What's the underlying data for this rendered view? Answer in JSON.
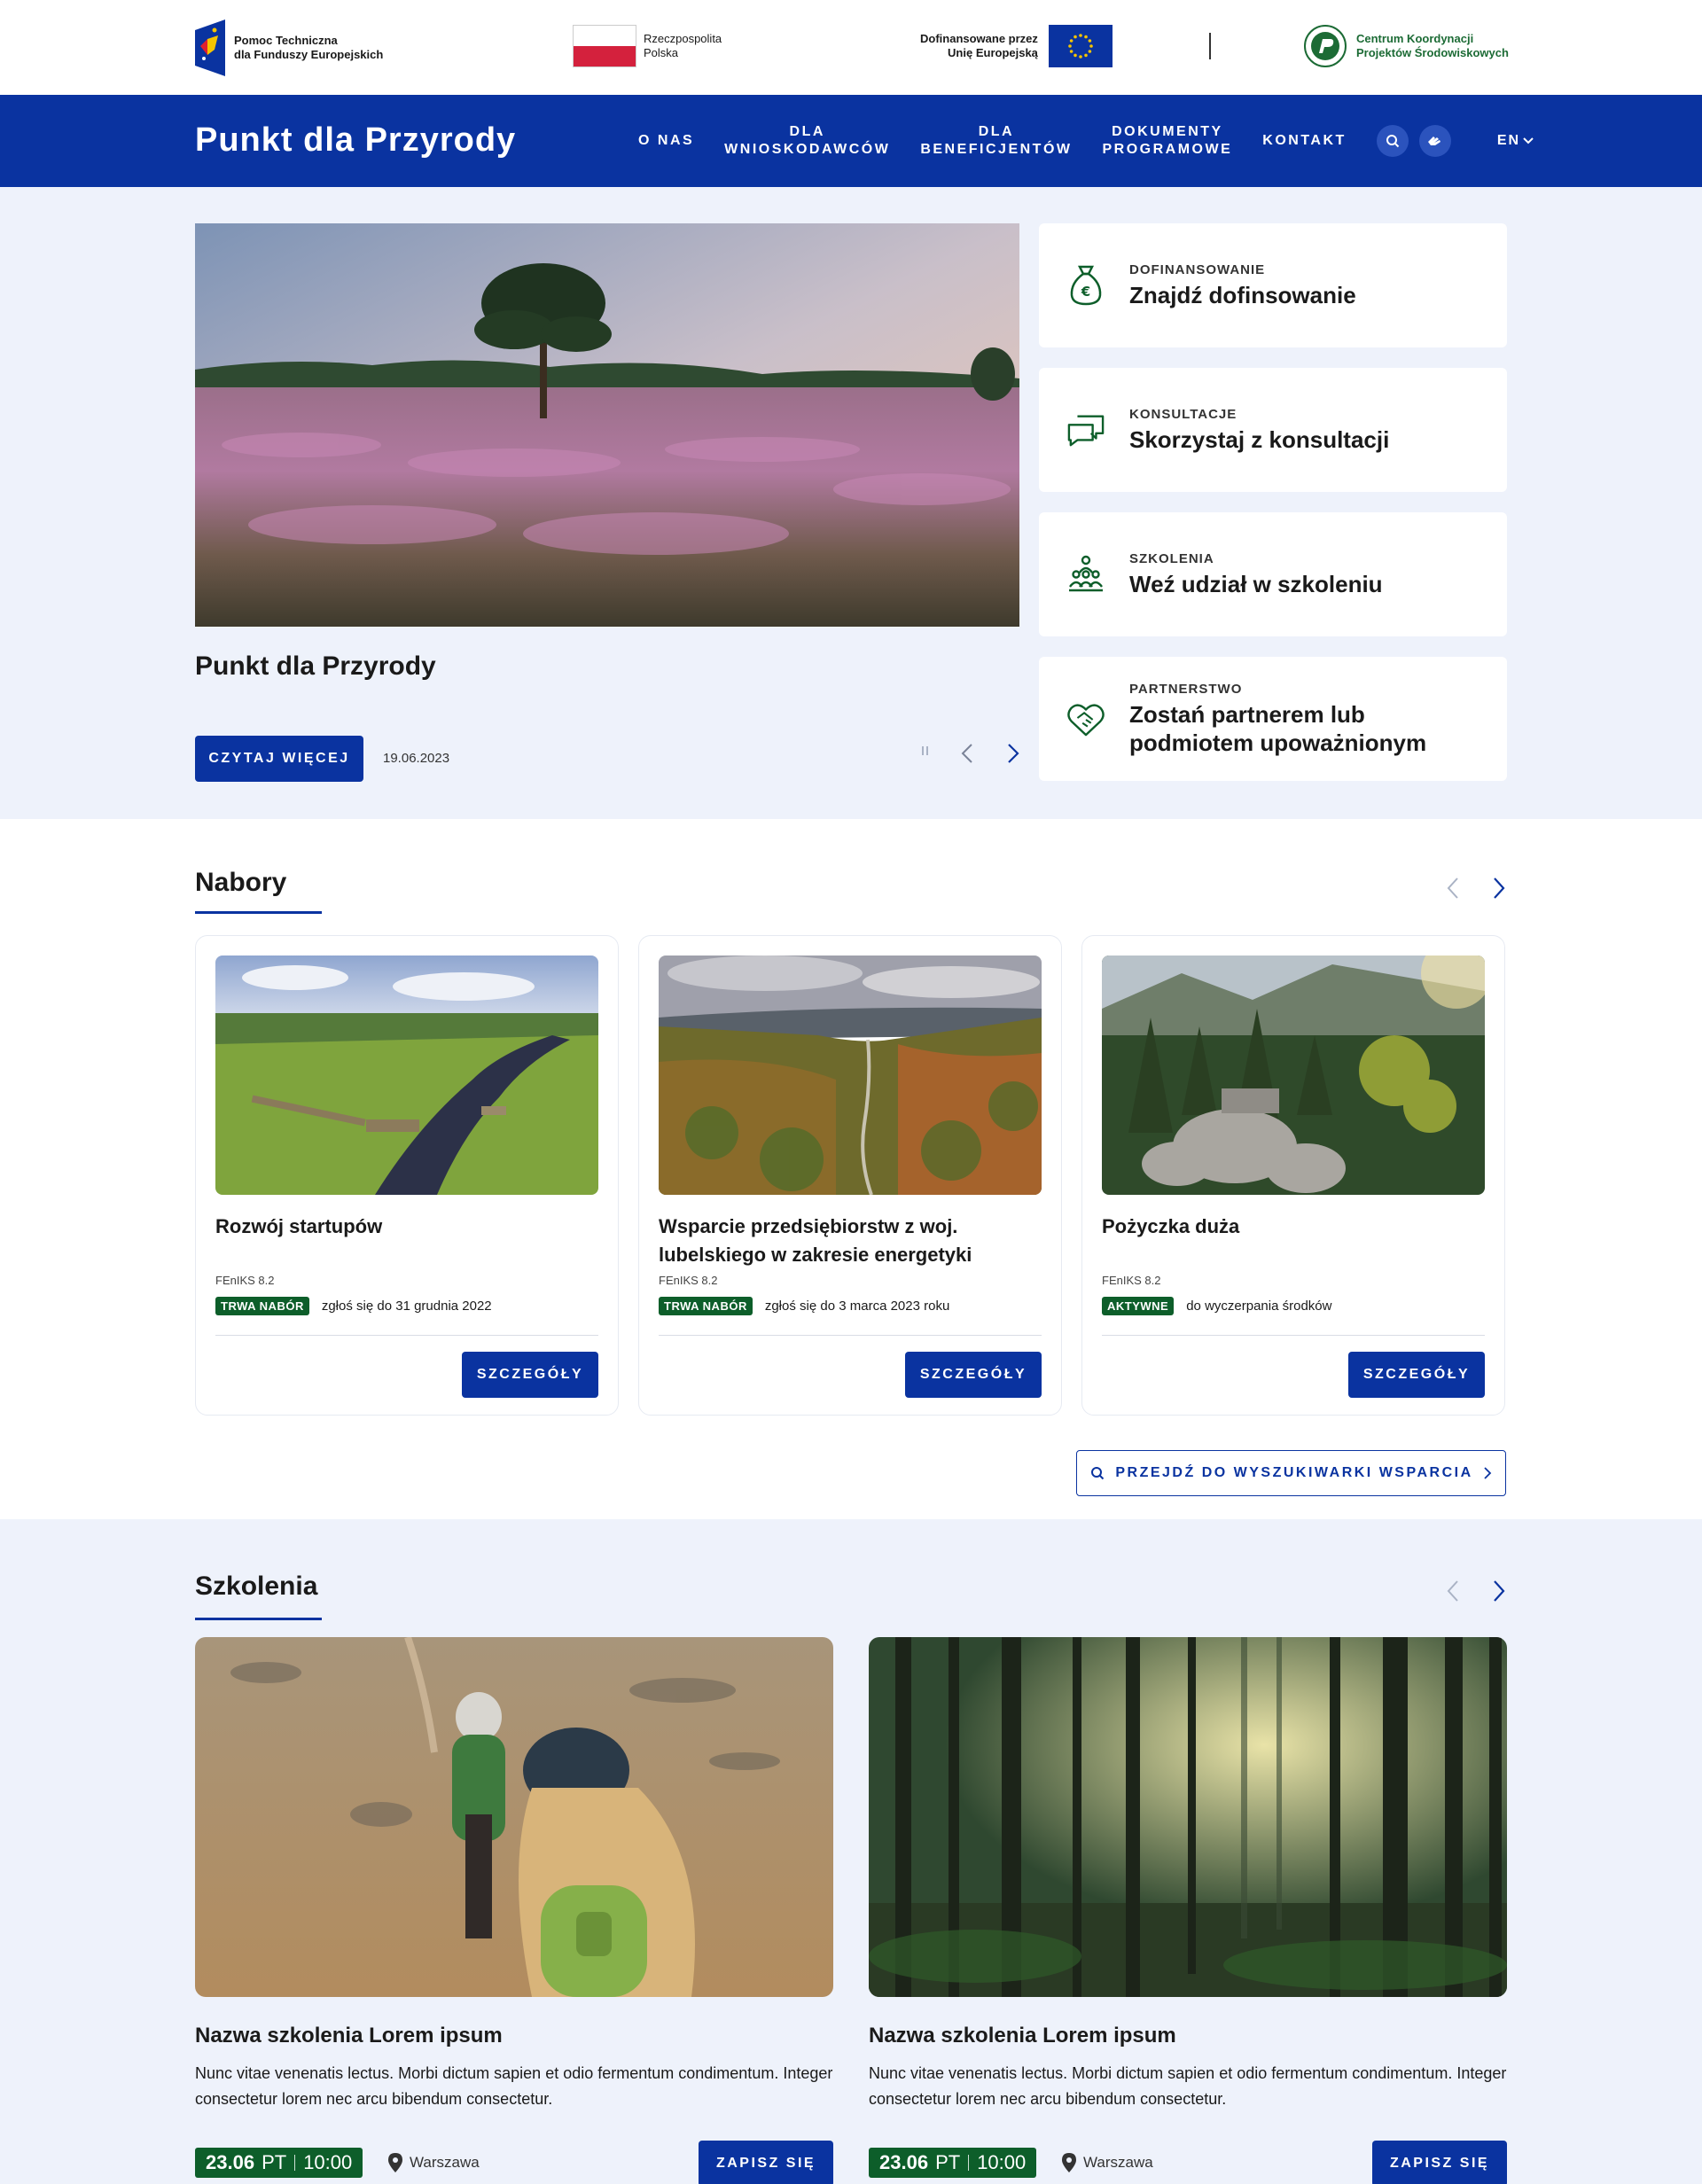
{
  "logos": {
    "fe_line1": "Pomoc Techniczna",
    "fe_line2": "dla Funduszy Europejskich",
    "pl_line1": "Rzeczpospolita",
    "pl_line2": "Polska",
    "eu_line1": "Dofinansowane przez",
    "eu_line2": "Unię Europejską",
    "ck_line1": "Centrum Koordynacji",
    "ck_line2": "Projektów Środowiskowych"
  },
  "nav": {
    "brand": "Punkt dla Przyrody",
    "items": [
      "O NAS",
      "DLA\nWNIOSKODAWCÓW",
      "DLA\nBENEFICJENTÓW",
      "DOKUMENTY\nPROGRAMOWE",
      "KONTAKT"
    ],
    "lang": "EN"
  },
  "hero": {
    "title": "Punkt dla Przyrody",
    "button": "CZYTAJ WIĘCEJ",
    "date": "19.06.2023"
  },
  "quick_links": [
    {
      "category": "DOFINANSOWANIE",
      "title": "Znajdź dofinsowanie"
    },
    {
      "category": "KONSULTACJE",
      "title": "Skorzystaj z konsultacji"
    },
    {
      "category": "SZKOLENIA",
      "title": "Weź udział w szkoleniu"
    },
    {
      "category": "PARTNERSTWO",
      "title": "Zostań partnerem lub podmiotem upoważnionym"
    }
  ],
  "nabory": {
    "title": "Nabory",
    "cards": [
      {
        "title": "Rozwój startupów",
        "program": "FEnIKS 8.2",
        "badge": "TRWA NABÓR",
        "status": "zgłoś się do 31 grudnia 2022",
        "button": "SZCZEGÓŁY"
      },
      {
        "title": "Wsparcie przedsiębiorstw z woj. lubelskiego w zakresie energetyki",
        "program": "FEnIKS 8.2",
        "badge": "TRWA NABÓR",
        "status": "zgłoś się do 3 marca 2023 roku",
        "button": "SZCZEGÓŁY"
      },
      {
        "title": "Pożyczka duża",
        "program": "FEnIKS 8.2",
        "badge": "AKTYWNE",
        "status": "do wyczerpania środków",
        "button": "SZCZEGÓŁY"
      }
    ],
    "search_button": "PRZEJDŹ DO WYSZUKIWARKI WSPARCIA"
  },
  "szkolenia": {
    "title": "Szkolenia",
    "items": [
      {
        "title": "Nazwa szkolenia Lorem ipsum",
        "desc": "Nunc vitae venenatis lectus. Morbi dictum sapien et odio fermentum condimentum. Integer consectetur lorem nec arcu bibendum consectetur.",
        "date": "23.06",
        "day": "PT",
        "time": "10:00",
        "location": "Warszawa",
        "button": "ZAPISZ SIĘ"
      },
      {
        "title": "Nazwa szkolenia Lorem ipsum",
        "desc": "Nunc vitae venenatis lectus. Morbi dictum sapien et odio fermentum condimentum. Integer consectetur lorem nec arcu bibendum consectetur.",
        "date": "23.06",
        "day": "PT",
        "time": "10:00",
        "location": "Warszawa",
        "button": "ZAPISZ SIĘ"
      }
    ]
  },
  "colors": {
    "primary": "#0a33a0",
    "green": "#0d5e2a",
    "light_bg": "#eef2fb"
  }
}
